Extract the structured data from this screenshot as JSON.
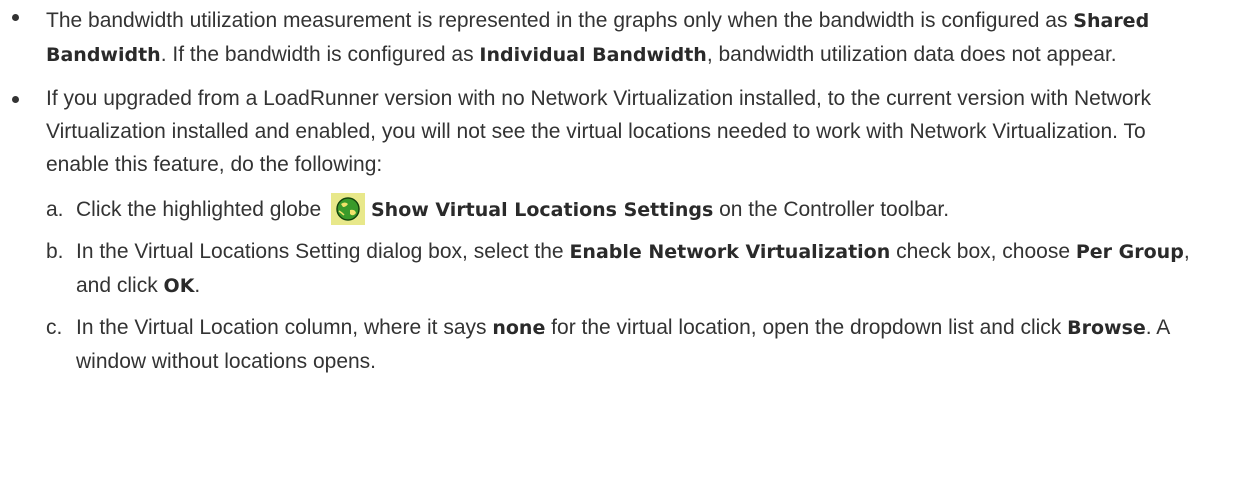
{
  "bullets": [
    {
      "parts": [
        "The bandwidth utilization measurement is represented in the graphs only when the bandwidth is configured as ",
        "Shared Bandwidth",
        ". If the bandwidth is configured as ",
        "Individual Bandwidth",
        ", bandwidth utilization data does not appear."
      ]
    },
    {
      "text": "If you upgraded from a LoadRunner version with no Network Virtualization installed, to the current version with Network Virtualization installed and enabled, you will not see the virtual locations needed to work with Network Virtualization. To enable this feature, do the following:",
      "steps": [
        {
          "marker": "a.",
          "parts": [
            "Click the highlighted globe ",
            "Show Virtual Locations Settings",
            " on the Controller toolbar."
          ],
          "icon": "globe-icon"
        },
        {
          "marker": "b.",
          "parts": [
            "In the Virtual Locations Setting dialog box, select the ",
            "Enable Network Virtualization",
            " check box, choose ",
            "Per Group",
            ", and click ",
            "OK",
            "."
          ]
        },
        {
          "marker": "c.",
          "parts": [
            "In the Virtual Location column, where it says ",
            "none",
            " for the virtual location, open the dropdown list and click ",
            "Browse",
            ". A window without locations opens."
          ]
        }
      ]
    }
  ],
  "colors": {
    "text": "#333333",
    "globe_background": "#e8e88a",
    "globe_fill": "#3a9a2a"
  }
}
